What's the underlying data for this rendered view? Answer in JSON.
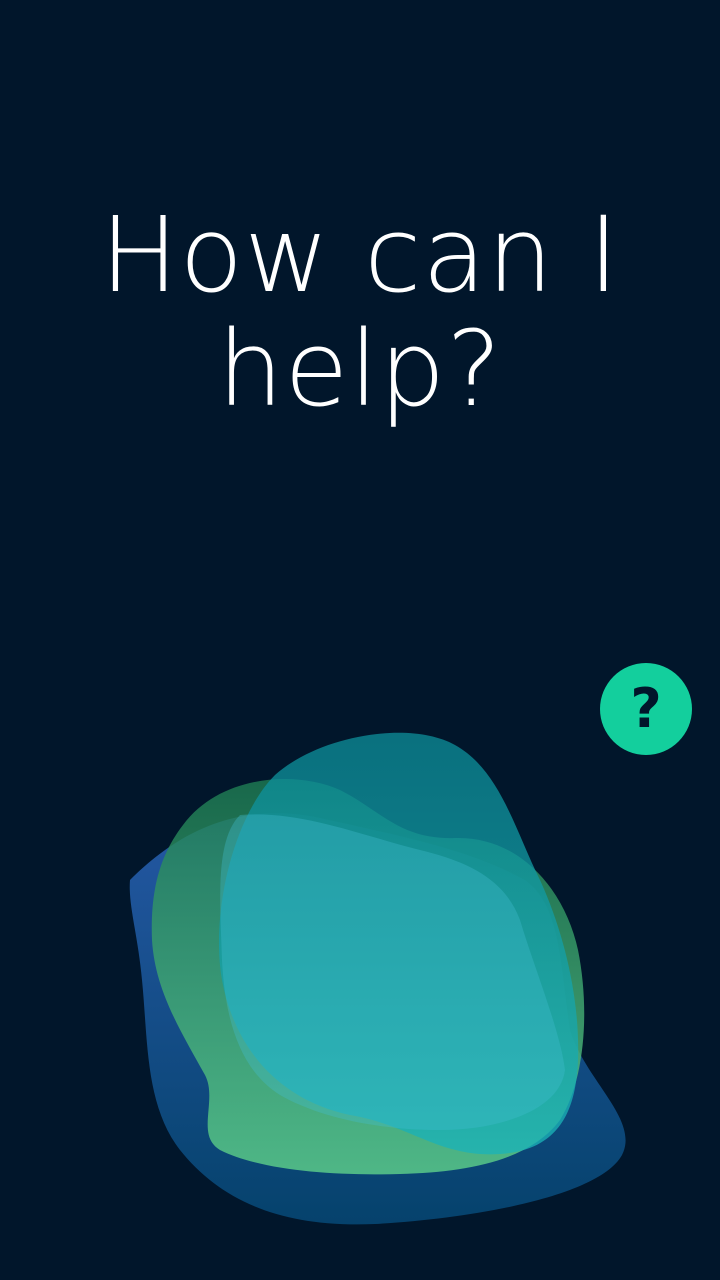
{
  "prompt": {
    "title": "How can I help?"
  },
  "help_button": {
    "label": "?",
    "icon": "question-mark-icon",
    "color": "#13cf9d"
  },
  "voice_visual": {
    "icon": "assistant-blob",
    "colors": [
      "#1a4d9e",
      "#1f9c72",
      "#11a8b0",
      "#3ad0c4"
    ]
  },
  "theme": {
    "background": "#01162b",
    "text": "#ffffff"
  }
}
